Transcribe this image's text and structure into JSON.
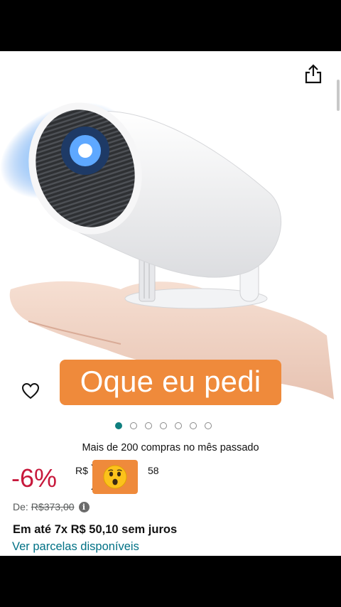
{
  "product": {
    "caption": "Oque eu pedi",
    "image_count": 7,
    "active_image_index": 0,
    "purchases_text": "Mais de 200 compras no mês passado",
    "discount": "-6%",
    "currency": "R$",
    "price_whole_visible": ")",
    "price_cents": "58",
    "overlay_emoji": "😲",
    "was_label": "De:",
    "was_price": "R$373,00",
    "info_icon_glyph": "i",
    "installments_text": "Em até 7x R$ 50,10 sem juros",
    "see_installments_link": "Ver parcelas disponíveis"
  },
  "icons": {
    "share": "share-icon",
    "wishlist": "heart-outline-icon",
    "info": "info-icon"
  },
  "colors": {
    "caption_bg": "#ef8a3b",
    "discount": "#c7183b",
    "link": "#007185",
    "active_dot": "#0f7f7f"
  }
}
